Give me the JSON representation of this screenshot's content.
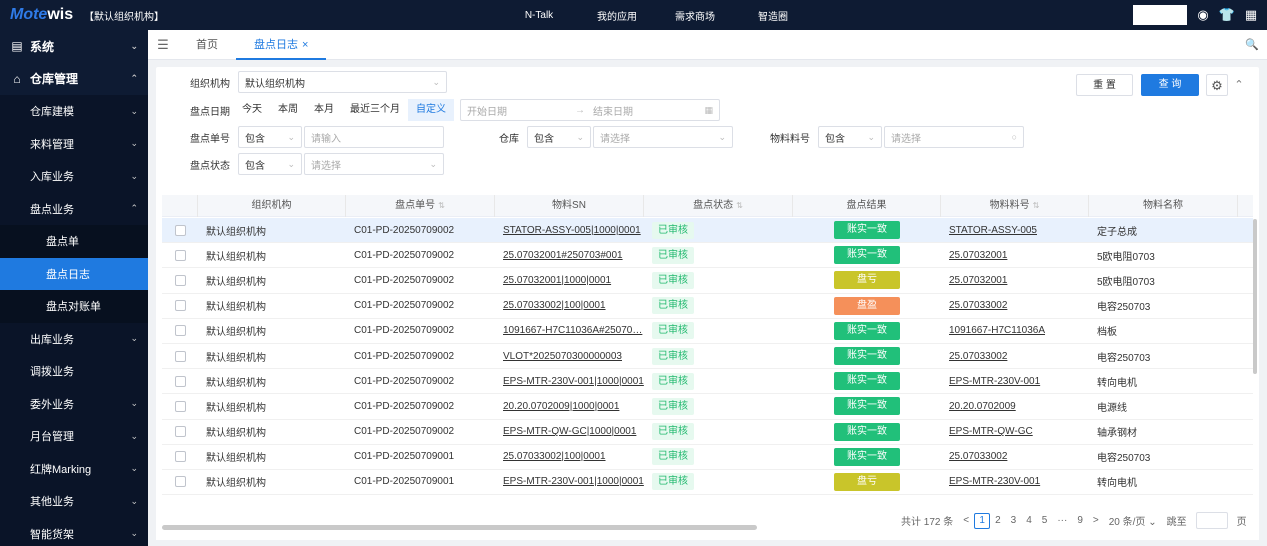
{
  "app": {
    "logo_text": "wis",
    "org": "【默认组织机构】"
  },
  "topnav": [
    "N-Talk",
    "我的应用",
    "需求商场",
    "智造圈"
  ],
  "sidebar": [
    {
      "label": "系统",
      "level": 1,
      "icon": "▤",
      "arrow": "⌄"
    },
    {
      "label": "仓库管理",
      "level": 1,
      "icon": "⌂",
      "arrow": "⌃"
    },
    {
      "label": "仓库建模",
      "level": 2,
      "arrow": "⌄"
    },
    {
      "label": "来料管理",
      "level": 2,
      "arrow": "⌄"
    },
    {
      "label": "入库业务",
      "level": 2,
      "arrow": "⌄"
    },
    {
      "label": "盘点业务",
      "level": 2,
      "arrow": "⌃"
    },
    {
      "label": "盘点单",
      "level": 3,
      "arrow": ""
    },
    {
      "label": "盘点日志",
      "level": 3,
      "arrow": "",
      "active": true
    },
    {
      "label": "盘点对账单",
      "level": 3,
      "arrow": ""
    },
    {
      "label": "出库业务",
      "level": 2,
      "arrow": "⌄"
    },
    {
      "label": "调拨业务",
      "level": 2,
      "arrow": ""
    },
    {
      "label": "委外业务",
      "level": 2,
      "arrow": "⌄"
    },
    {
      "label": "月台管理",
      "level": 2,
      "arrow": "⌄"
    },
    {
      "label": "红牌Marking",
      "level": 2,
      "arrow": "⌄"
    },
    {
      "label": "其他业务",
      "level": 2,
      "arrow": "⌄"
    },
    {
      "label": "智能货架",
      "level": 2,
      "arrow": "⌄"
    }
  ],
  "tabs": {
    "home": "首页",
    "current": "盘点日志",
    "close": "×"
  },
  "filter": {
    "org_label": "组织机构",
    "org_value": "默认组织机构",
    "date_label": "盘点日期",
    "quick": [
      "今天",
      "本周",
      "本月",
      "最近三个月",
      "自定义"
    ],
    "start_ph": "开始日期",
    "end_ph": "结束日期",
    "arrow": "→",
    "no_label": "盘点单号",
    "contains": "包含",
    "input_ph": "请输入",
    "wh_label": "仓库",
    "select_ph": "请选择",
    "mat_label": "物料料号",
    "status_label": "盘点状态",
    "reset": "重 置",
    "query": "查 询"
  },
  "table": {
    "headers": [
      "组织机构",
      "盘点单号",
      "物料SN",
      "盘点状态",
      "盘点结果",
      "物料料号",
      "物料名称"
    ],
    "rows": [
      [
        "默认组织机构",
        "C01-PD-20250709002",
        "STATOR-ASSY-005|1000|0001",
        "已审核",
        "账实一致",
        "STATOR-ASSY-005",
        "定子总成"
      ],
      [
        "默认组织机构",
        "C01-PD-20250709002",
        "25.07032001#250703#001",
        "已审核",
        "账实一致",
        "25.07032001",
        "5欧电阻0703"
      ],
      [
        "默认组织机构",
        "C01-PD-20250709002",
        "25.07032001|1000|0001",
        "已审核",
        "盘亏",
        "25.07032001",
        "5欧电阻0703"
      ],
      [
        "默认组织机构",
        "C01-PD-20250709002",
        "25.07033002|100|0001",
        "已审核",
        "盘盈",
        "25.07033002",
        "电容250703"
      ],
      [
        "默认组织机构",
        "C01-PD-20250709002",
        "1091667-H7C11036A#25070…",
        "已审核",
        "账实一致",
        "1091667-H7C11036A",
        "档板"
      ],
      [
        "默认组织机构",
        "C01-PD-20250709002",
        "VLOT*2025070300000003",
        "已审核",
        "账实一致",
        "25.07033002",
        "电容250703"
      ],
      [
        "默认组织机构",
        "C01-PD-20250709002",
        "EPS-MTR-230V-001|1000|0001",
        "已审核",
        "账实一致",
        "EPS-MTR-230V-001",
        "转向电机"
      ],
      [
        "默认组织机构",
        "C01-PD-20250709002",
        "20.20.0702009|1000|0001",
        "已审核",
        "账实一致",
        "20.20.0702009",
        "电源线"
      ],
      [
        "默认组织机构",
        "C01-PD-20250709002",
        "EPS-MTR-QW-GC|1000|0001",
        "已审核",
        "账实一致",
        "EPS-MTR-QW-GC",
        "轴承钢材"
      ],
      [
        "默认组织机构",
        "C01-PD-20250709001",
        "25.07033002|100|0001",
        "已审核",
        "账实一致",
        "25.07033002",
        "电容250703"
      ],
      [
        "默认组织机构",
        "C01-PD-20250709001",
        "EPS-MTR-230V-001|1000|0001",
        "已审核",
        "盘亏",
        "EPS-MTR-230V-001",
        "转向电机"
      ]
    ]
  },
  "result_colors": {
    "账实一致": "#21c07a",
    "盘亏": "#c9c52a",
    "盘盈": "#f5905a"
  },
  "pager": {
    "total": "共计 172 条",
    "pages": [
      "1",
      "2",
      "3",
      "4",
      "5",
      "···",
      "9"
    ],
    "size": "20 条/页",
    "jump": "跳至",
    "page_unit": "页",
    "prev": "<",
    "next": ">"
  }
}
